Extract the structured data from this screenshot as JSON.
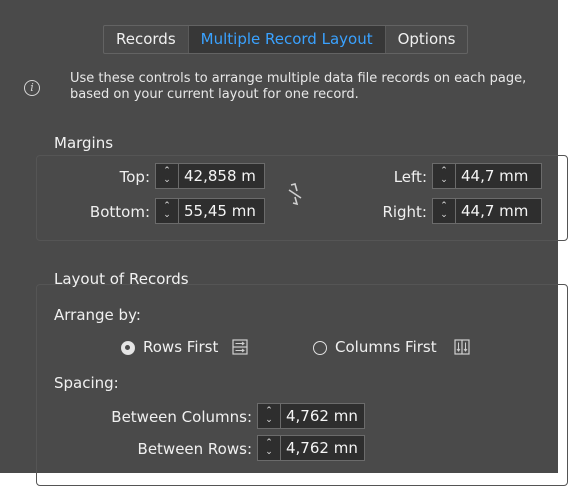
{
  "tabs": [
    "Records",
    "Multiple Record Layout",
    "Options"
  ],
  "active_tab": 1,
  "info": {
    "icon": "info-icon",
    "text": "Use these controls to arrange multiple data file records on each page, based on your current layout for one record."
  },
  "margins": {
    "title": "Margins",
    "top_label": "Top:",
    "top_value": "42,858 m",
    "bottom_label": "Bottom:",
    "bottom_value": "55,45 mn",
    "left_label": "Left:",
    "left_value": "44,7 mm",
    "right_label": "Right:",
    "right_value": "44,7 mm",
    "link_icon": "broken-chain-icon"
  },
  "layout": {
    "title": "Layout of Records",
    "arrange_label": "Arrange by:",
    "rows_first": "Rows First",
    "columns_first": "Columns First",
    "selected": "rows",
    "spacing_label": "Spacing:",
    "between_columns_label": "Between Columns:",
    "between_columns_value": "4,762 mn",
    "between_rows_label": "Between Rows:",
    "between_rows_value": "4,762 mn"
  },
  "colors": {
    "panel": "#4a4a4a",
    "active_tab_text": "#3aa2ff",
    "field_bg": "#2e2e2e"
  }
}
